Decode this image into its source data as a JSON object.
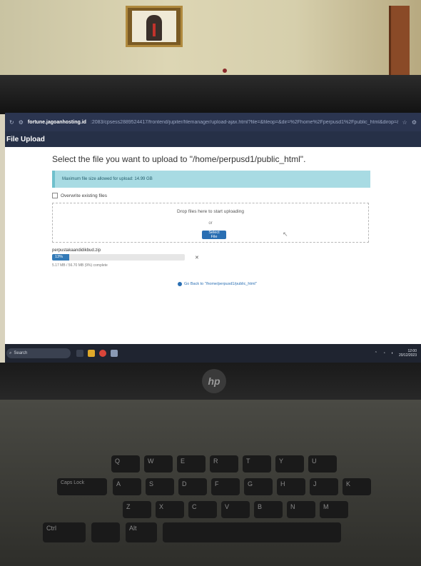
{
  "browser": {
    "domain": "fortune.jagoanhosting.id",
    "url": ":2083/cpsess2889524417/frontend/jupiter/filemanager/upload-ajax.html?file=&fileop=&dir=%2Fhome%2Fperpusd1%2Fpublic_html&dirop=&charset=&file_charset=&baseurl=&basedir="
  },
  "window": {
    "title": "File Upload"
  },
  "upload": {
    "heading": "Select the file you want to upload to \"/home/perpusd1/public_html\".",
    "max_notice": "Maximum file size allowed for upload: 14.99 GB",
    "overwrite_label": "Overwrite existing files",
    "drop_text": "Drop files here to start uploading",
    "or_text": "or",
    "select_button": "Select File",
    "file_name": "perpustakaandidikbud.zip",
    "progress_label": "13%",
    "progress_value": 13,
    "file_status": "5.17 MB / 56.70 MB (9%) complete",
    "go_back": "Go Back to \"/home/perpusd1/public_html\""
  },
  "taskbar": {
    "search_label": "Search",
    "time": "12:00",
    "date": "20/12/2023"
  },
  "laptop": {
    "brand": "hp"
  },
  "keyboard": {
    "keys": [
      "Caps Lock",
      "Ctrl",
      "Alt",
      "Q",
      "W",
      "E",
      "R",
      "T",
      "Y",
      "U",
      "A",
      "S",
      "D",
      "F",
      "G",
      "H",
      "J",
      "K",
      "Z",
      "X",
      "C",
      "V",
      "B",
      "N",
      "M"
    ]
  },
  "colors": {
    "header_bg": "#263047",
    "alert_bg": "#a8dbe3",
    "button_bg": "#2a6fb3",
    "progress_fill": "#337ab7"
  }
}
